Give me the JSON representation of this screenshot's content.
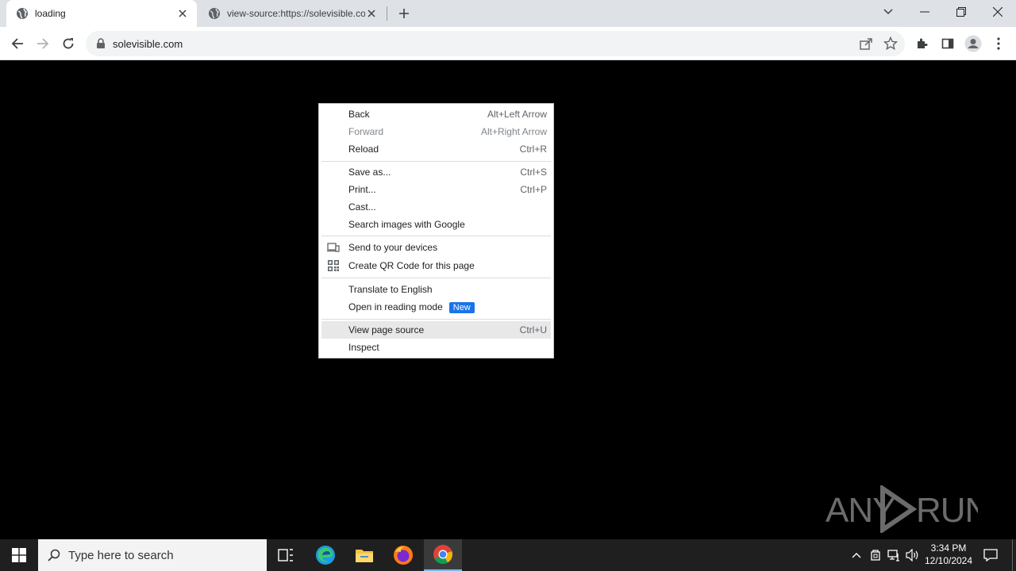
{
  "browser": {
    "tabs": [
      {
        "title": "loading",
        "active": true
      },
      {
        "title": "view-source:https://solevisible.com",
        "active": false
      }
    ],
    "address_bar": {
      "url": "solevisible.com"
    }
  },
  "context_menu": {
    "items": [
      {
        "label": "Back",
        "shortcut": "Alt+Left Arrow"
      },
      {
        "label": "Forward",
        "shortcut": "Alt+Right Arrow",
        "disabled": true
      },
      {
        "label": "Reload",
        "shortcut": "Ctrl+R"
      },
      {
        "label": "Save as...",
        "shortcut": "Ctrl+S"
      },
      {
        "label": "Print...",
        "shortcut": "Ctrl+P"
      },
      {
        "label": "Cast..."
      },
      {
        "label": "Search images with Google"
      },
      {
        "label": "Send to your devices",
        "icon": "devices-icon"
      },
      {
        "label": "Create QR Code for this page",
        "icon": "qr-code-icon"
      },
      {
        "label": "Translate to English"
      },
      {
        "label": "Open in reading mode",
        "badge": "New"
      },
      {
        "label": "View page source",
        "shortcut": "Ctrl+U",
        "highlighted": true
      },
      {
        "label": "Inspect"
      }
    ]
  },
  "watermark": {
    "text": "ANY RUN"
  },
  "taskbar": {
    "search_placeholder": "Type here to search",
    "pinned": [
      "task-view-icon",
      "edge-icon",
      "file-explorer-icon",
      "firefox-icon",
      "chrome-icon"
    ],
    "clock": {
      "time": "3:34 PM",
      "date": "12/10/2024"
    }
  },
  "colors": {
    "accent": "#1a73e8",
    "taskbar": "#1f1f1f",
    "tabstrip": "#dee1e6"
  }
}
